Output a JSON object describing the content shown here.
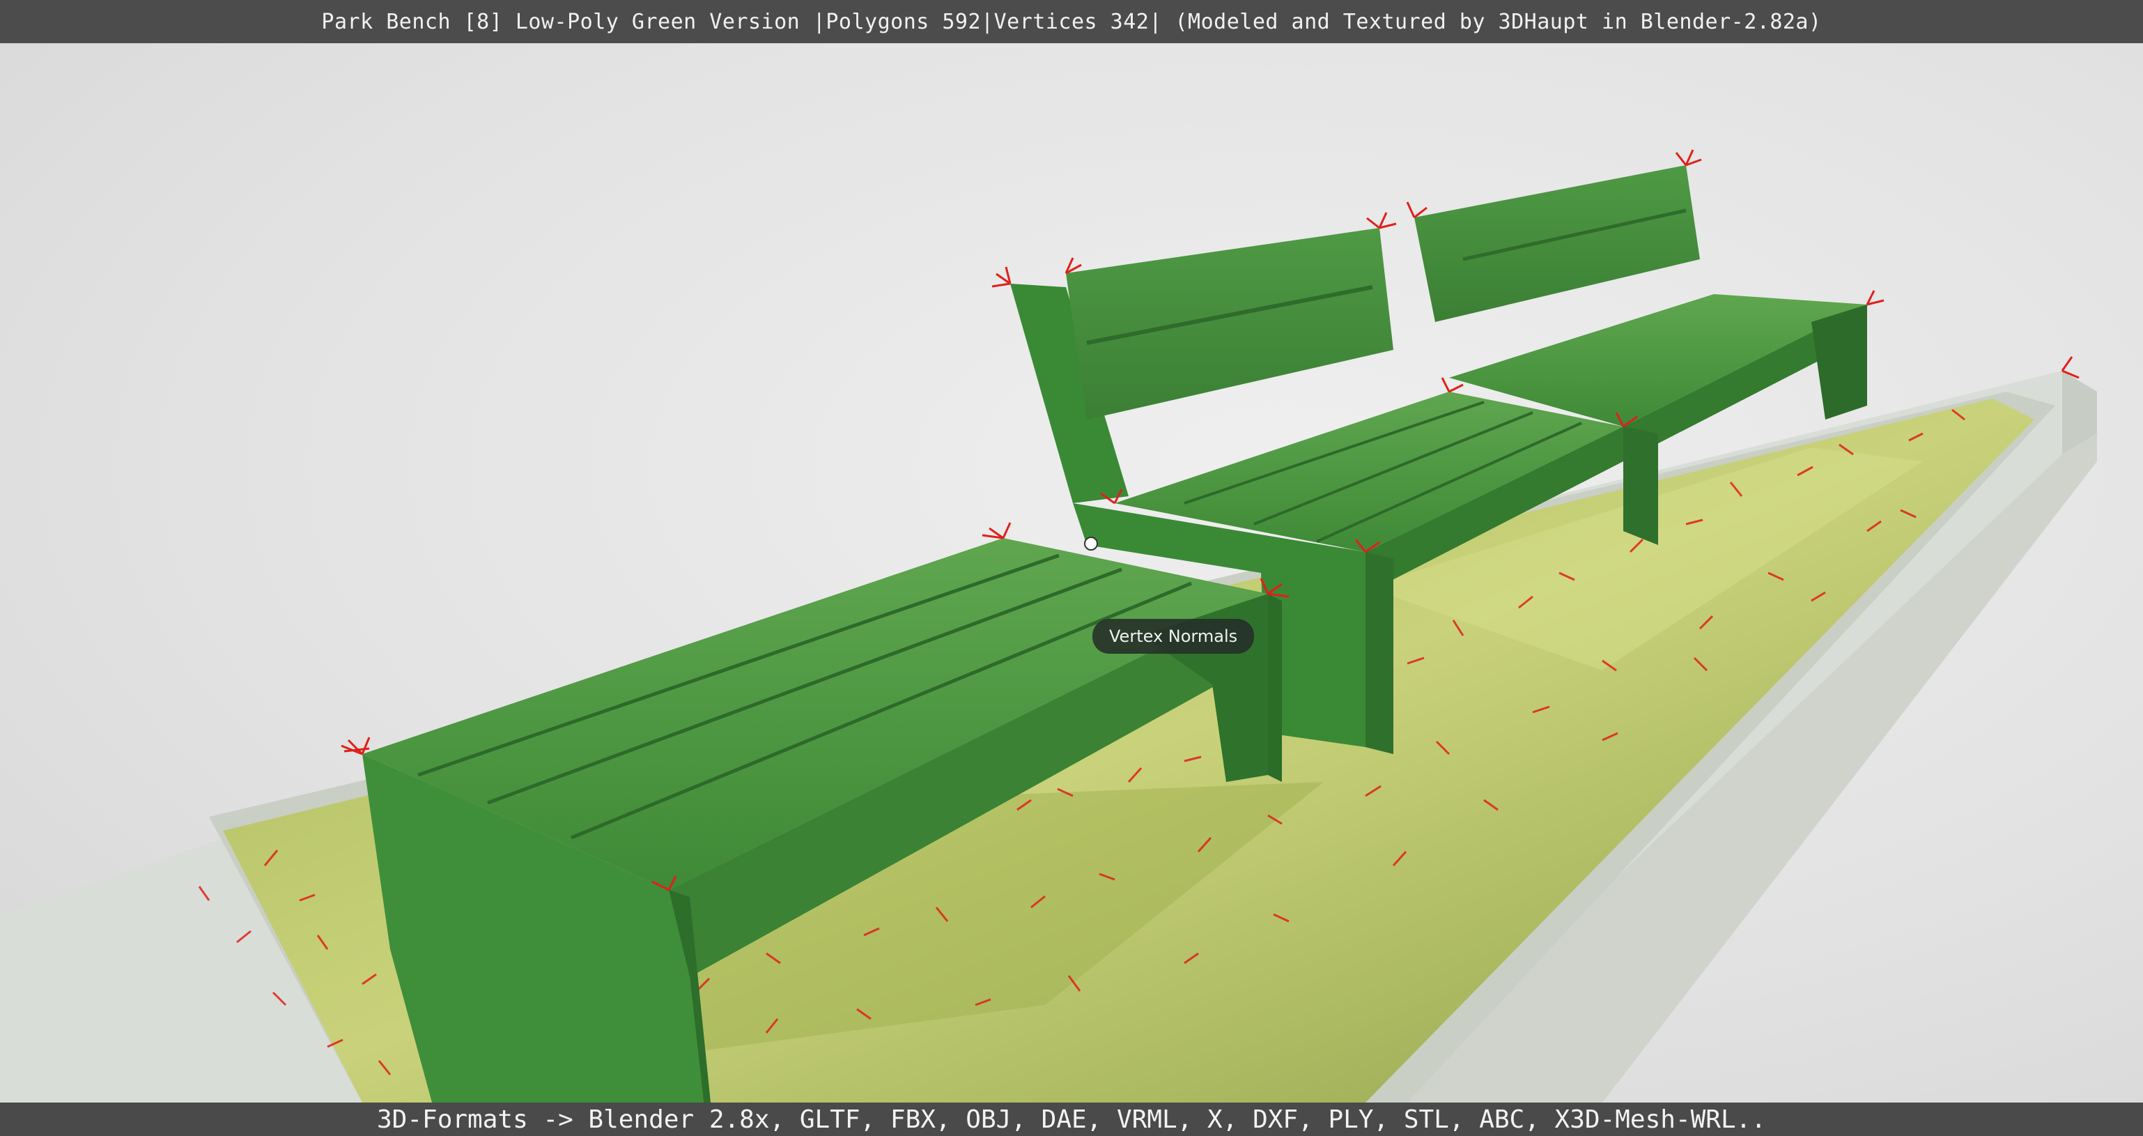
{
  "header": {
    "title": "Park Bench [8] Low-Poly Green Version |Polygons 592|Vertices 342| (Modeled and Textured by 3DHaupt in Blender-2.82a)"
  },
  "viewport": {
    "tooltip": "Vertex Normals",
    "colors": {
      "background": "#e4e4e4",
      "bench_green": "#3f8f3a",
      "bench_dark": "#2c6e2a",
      "grass": "#b9c46a",
      "normals": "#e0201a",
      "planter": "#d8dcd6"
    }
  },
  "footer": {
    "formats": "3D-Formats -> Blender 2.8x, GLTF, FBX, OBJ, DAE, VRML, X, DXF, PLY, STL, ABC, X3D-Mesh-WRL.."
  }
}
